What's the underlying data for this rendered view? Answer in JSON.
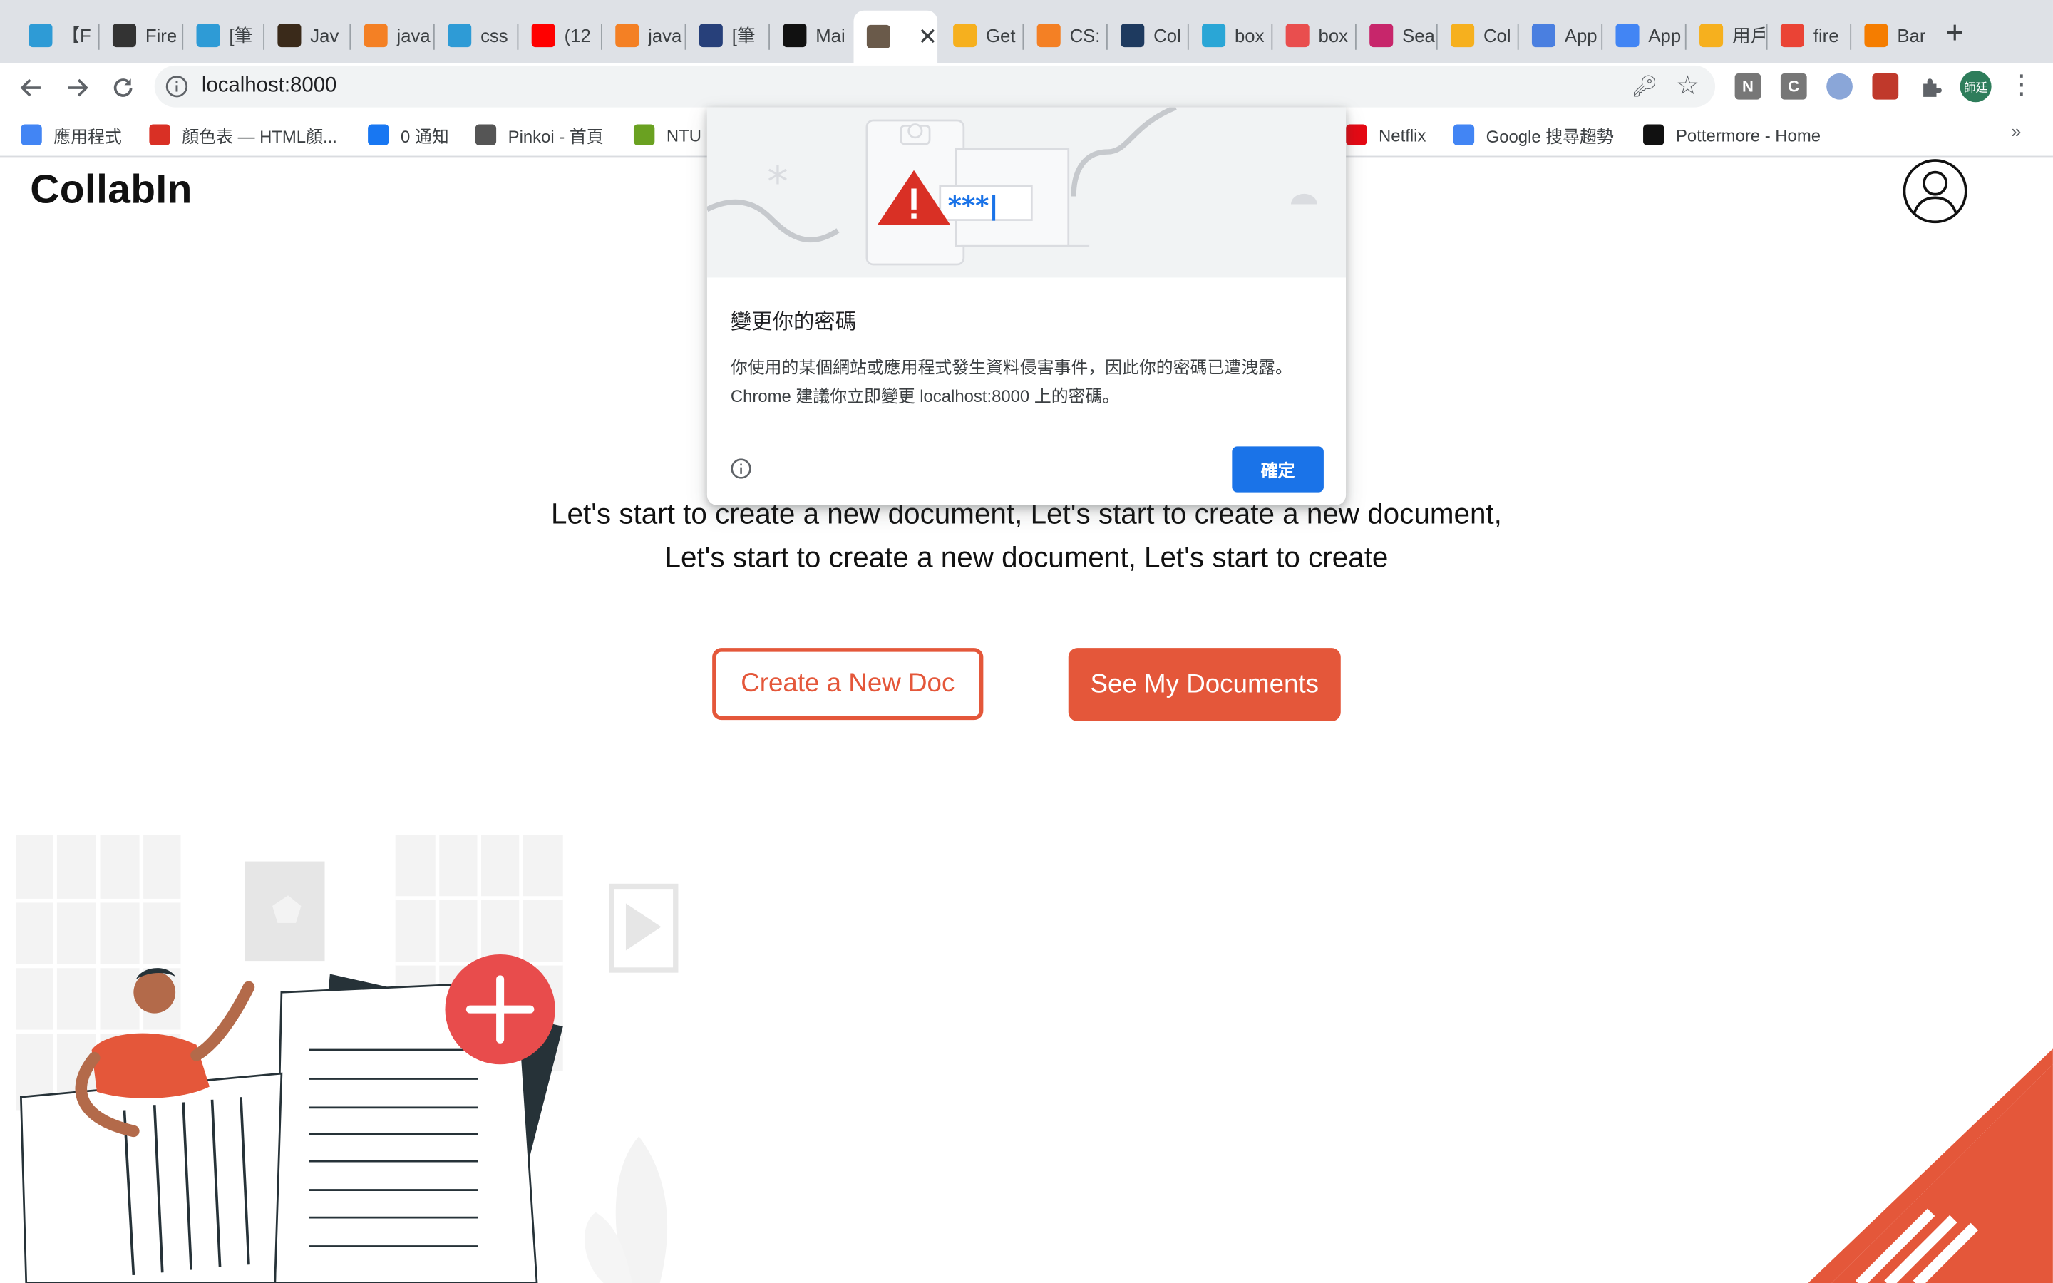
{
  "browser": {
    "tabs": [
      {
        "title": "【F",
        "icon": "wordpress-icon",
        "color": "#2e9bd6"
      },
      {
        "title": "Fire",
        "icon": "letter-l-icon",
        "color": "#333333"
      },
      {
        "title": "[筆",
        "icon": "wordpress-icon",
        "color": "#2e9bd6"
      },
      {
        "title": "Jav",
        "icon": "letter-t-icon",
        "color": "#3a2a1a"
      },
      {
        "title": "java",
        "icon": "stackoverflow-icon",
        "color": "#f48024"
      },
      {
        "title": "css",
        "icon": "wordpress-icon",
        "color": "#2e9bd6"
      },
      {
        "title": "(12",
        "icon": "youtube-icon",
        "color": "#ff0000"
      },
      {
        "title": "java",
        "icon": "stackoverflow-icon",
        "color": "#f48024"
      },
      {
        "title": "[筆",
        "icon": "pj-icon",
        "color": "#27407a"
      },
      {
        "title": "Mai",
        "icon": "medium-icon",
        "color": "#111111"
      },
      {
        "title": "",
        "icon": "avatar-face-icon",
        "color": "#6a5a4a",
        "active": true
      },
      {
        "title": "Get",
        "icon": "firebase-icon",
        "color": "#f6b01e"
      },
      {
        "title": "CS:",
        "icon": "stackoverflow-icon",
        "color": "#f48024"
      },
      {
        "title": "Col",
        "icon": "trello-icon",
        "color": "#1e3a5f"
      },
      {
        "title": "box",
        "icon": "bird-icon",
        "color": "#2aa6d6"
      },
      {
        "title": "box",
        "icon": "flower-icon",
        "color": "#e94e4e"
      },
      {
        "title": "Sea",
        "icon": "dribbble-icon",
        "color": "#c7266b"
      },
      {
        "title": "Col",
        "icon": "firebase-icon",
        "color": "#f6b01e"
      },
      {
        "title": "App",
        "icon": "gcp-icon",
        "color": "#4a7fe0"
      },
      {
        "title": "App",
        "icon": "cloud-icon",
        "color": "#4285f4"
      },
      {
        "title": "用戶",
        "icon": "firebase-icon",
        "color": "#f6b01e"
      },
      {
        "title": "fire",
        "icon": "google-icon",
        "color": "#ea4335"
      },
      {
        "title": "Bar",
        "icon": "blogger-icon",
        "color": "#f57d00"
      }
    ],
    "url": "localhost:8000",
    "extensions": [
      {
        "label": "N",
        "color": "#777777"
      },
      {
        "label": "C",
        "color": "#777777"
      },
      {
        "label": "",
        "color": "#8aa6d8"
      },
      {
        "label": "",
        "color": "#c0392b"
      }
    ],
    "profile_label": "師廷",
    "bookmarks": [
      {
        "label": "應用程式",
        "icon": "apps-grid-icon",
        "color": "#4285f4"
      },
      {
        "label": "顏色表 — HTML顏...",
        "icon": "color-wheel-icon",
        "color": "#d93025"
      },
      {
        "label": "0 通知",
        "icon": "facebook-icon",
        "color": "#1877f2"
      },
      {
        "label": "Pinkoi - 首頁",
        "icon": "pinkoi-icon",
        "color": "#555555"
      },
      {
        "label": "NTU",
        "icon": "ntu-icon",
        "color": "#6aa121"
      },
      {
        "label": "Netflix",
        "icon": "netflix-icon",
        "color": "#e50914"
      },
      {
        "label": "Google 搜尋趨勢",
        "icon": "trends-icon",
        "color": "#4285f4"
      },
      {
        "label": "Pottermore - Home",
        "icon": "pottermore-icon",
        "color": "#111111"
      }
    ]
  },
  "page": {
    "logo": "CollabIn",
    "hero_text": "Let's start to create a new document, Let's start to create a new document, Let's start to create a new document, Let's start to create",
    "create_button": "Create a New Doc",
    "documents_button": "See My Documents",
    "accent_color": "#e4573a"
  },
  "dialog": {
    "title": "變更你的密碼",
    "body_line1": "你使用的某個網站或應用程式發生資料侵害事件，因此你的密碼已遭洩露。",
    "body_line2": "Chrome 建議你立即變更 localhost:8000 上的密碼。",
    "password_mask": "***|",
    "ok_button": "確定",
    "button_color": "#1a73e8"
  }
}
